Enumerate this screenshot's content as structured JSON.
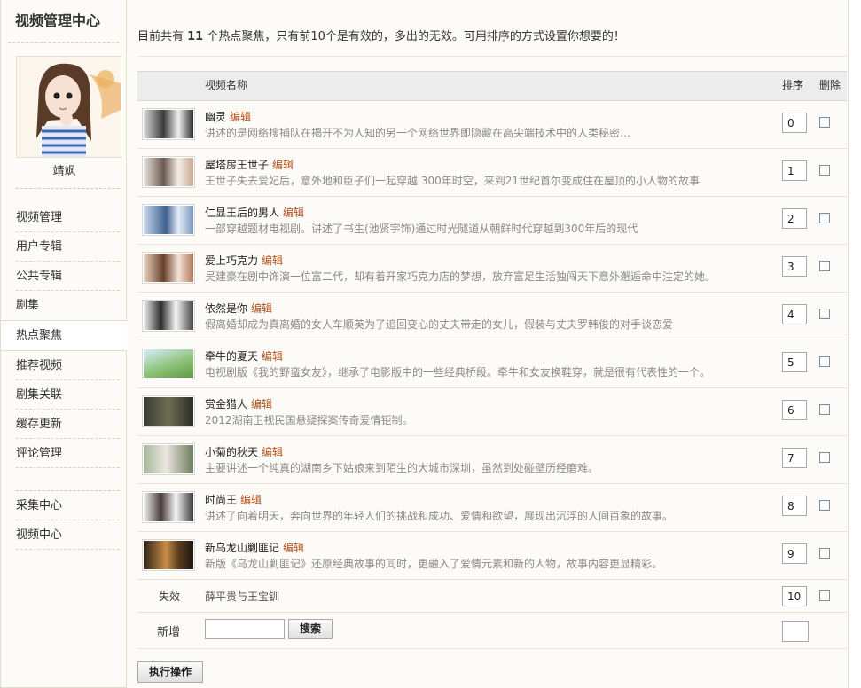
{
  "sidebar": {
    "title": "视频管理中心",
    "username": "靖飒",
    "nav_group1": [
      "视频管理",
      "用户专辑",
      "公共专辑",
      "剧集"
    ],
    "active_item": "热点聚焦",
    "nav_group2": [
      "推荐视频",
      "剧集关联",
      "缓存更新",
      "评论管理"
    ],
    "nav_group3": [
      "采集中心",
      "视频中心"
    ]
  },
  "notice": {
    "prefix": "目前共有 ",
    "count": "11",
    "suffix": " 个热点聚焦，只有前10个是有效的，多出的无效。可用排序的方式设置你想要的！"
  },
  "table": {
    "col_name": "视频名称",
    "col_order": "排序",
    "col_delete": "删除",
    "edit_label": "编辑",
    "rows": [
      {
        "title": "幽灵",
        "desc": "讲述的是网络搜捕队在揭开不为人知的另一个网络世界即隐藏在高尖端技术中的人类秘密…",
        "order": "0"
      },
      {
        "title": "屋塔房王世子",
        "desc": "王世子失去爱妃后，意外地和臣子们一起穿越 300年时空，来到21世纪首尔变成住在屋顶的小人物的故事",
        "order": "1"
      },
      {
        "title": "仁显王后的男人",
        "desc": "一部穿越题材电视剧。讲述了书生(池贤宇饰)通过时光隧道从朝鲜时代穿越到300年后的现代",
        "order": "2"
      },
      {
        "title": "爱上巧克力",
        "desc": "吴建豪在剧中饰演一位富二代，却有着开家巧克力店的梦想，放弃富足生活独闯天下意外邂逅命中注定的她。",
        "order": "3"
      },
      {
        "title": "依然是你",
        "desc": "假离婚却成为真离婚的女人车顺英为了追回变心的丈夫带走的女儿，假装与丈夫罗韩俊的对手谈恋爱",
        "order": "4"
      },
      {
        "title": "牵牛的夏天",
        "desc": "电视剧版《我的野蛮女友》，继承了电影版中的一些经典桥段。牵牛和女友换鞋穿，就是很有代表性的一个。",
        "order": "5"
      },
      {
        "title": "赏金猎人",
        "desc": "2012湖南卫视民国悬疑探案传奇爱情钜制。",
        "order": "6"
      },
      {
        "title": "小菊的秋天",
        "desc": "主要讲述一个纯真的湖南乡下姑娘来到陌生的大城市深圳，虽然到处碰壁历经磨难。",
        "order": "7"
      },
      {
        "title": "时尚王",
        "desc": "讲述了向着明天，奔向世界的年轻人们的挑战和成功、爱情和欲望，展现出沉浮的人间百象的故事。",
        "order": "8"
      },
      {
        "title": "新乌龙山剿匪记",
        "desc": "新版《乌龙山剿匪记》还原经典故事的同时，更融入了爱情元素和新的人物，故事内容更显精彩。",
        "order": "9"
      }
    ],
    "invalid": {
      "label": "失效",
      "title": "薛平贵与王宝钏",
      "order": "10"
    },
    "add": {
      "label": "新增",
      "search_button": "搜索",
      "value": "",
      "order": ""
    }
  },
  "execute_button": "执行操作",
  "colors": {
    "edit": "#b3501b",
    "desc": "#8a8a8a",
    "header_bg": "#ececec",
    "panel_bg": "#fcfbf7"
  }
}
